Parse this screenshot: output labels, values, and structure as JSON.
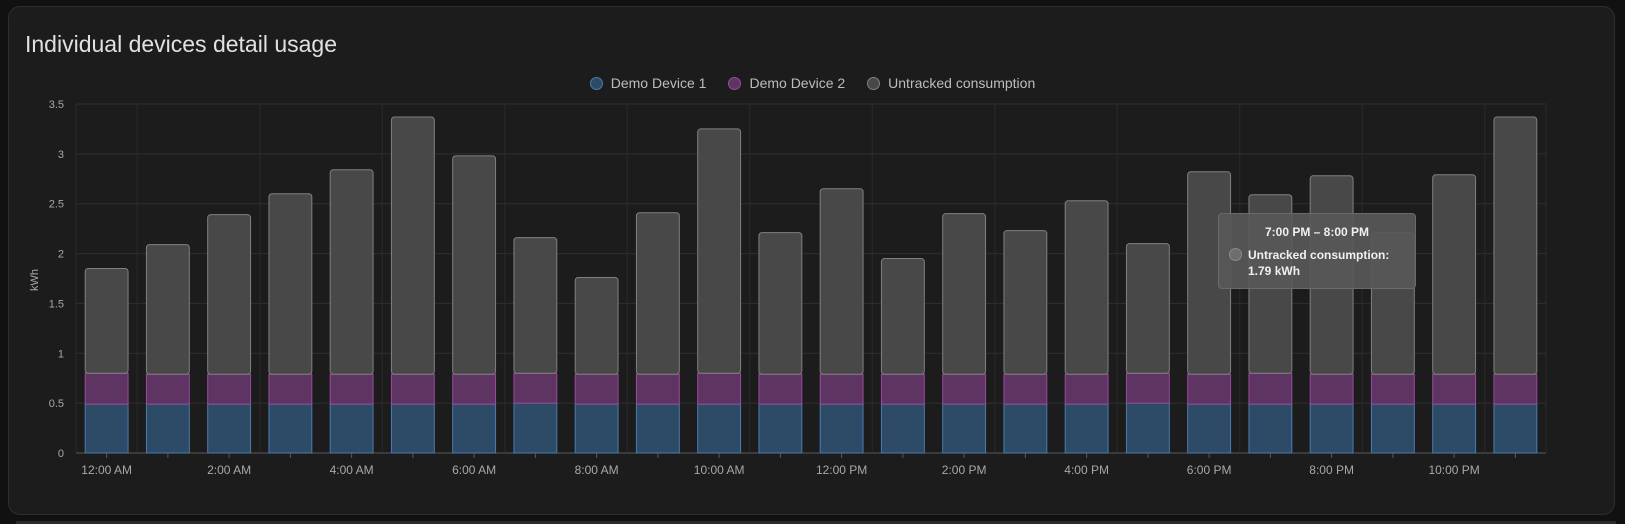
{
  "card": {
    "title": "Individual devices detail usage"
  },
  "chart_data": {
    "type": "bar",
    "stacked": true,
    "ylabel": "kWh",
    "ylim": [
      0,
      3.5
    ],
    "yticks": [
      "0",
      "0.5",
      "1",
      "1.5",
      "2",
      "2.5",
      "3",
      "3.5"
    ],
    "x_tick_labels": [
      "12:00 AM",
      "2:00 AM",
      "4:00 AM",
      "6:00 AM",
      "8:00 AM",
      "10:00 AM",
      "12:00 PM",
      "2:00 PM",
      "4:00 PM",
      "6:00 PM",
      "8:00 PM",
      "10:00 PM"
    ],
    "legend_position": "top-center",
    "grid": true,
    "series": [
      {
        "name": "Demo Device 1",
        "color": "#4a7bb0",
        "fill": "#2d4a66",
        "values": [
          0.49,
          0.49,
          0.49,
          0.49,
          0.49,
          0.49,
          0.49,
          0.5,
          0.49,
          0.49,
          0.49,
          0.49,
          0.49,
          0.49,
          0.49,
          0.49,
          0.49,
          0.5,
          0.49,
          0.49,
          0.49,
          0.49,
          0.49,
          0.49
        ]
      },
      {
        "name": "Demo Device 2",
        "color": "#9a4a9e",
        "fill": "#5e3462",
        "values": [
          0.31,
          0.3,
          0.3,
          0.3,
          0.3,
          0.3,
          0.3,
          0.3,
          0.3,
          0.3,
          0.31,
          0.3,
          0.3,
          0.3,
          0.3,
          0.3,
          0.3,
          0.3,
          0.3,
          0.31,
          0.3,
          0.3,
          0.3,
          0.3
        ]
      },
      {
        "name": "Untracked consumption",
        "color": "#808080",
        "fill": "#484848",
        "values": [
          1.05,
          1.3,
          1.6,
          1.81,
          2.05,
          2.58,
          2.19,
          1.36,
          0.97,
          1.62,
          2.45,
          1.42,
          1.86,
          1.16,
          1.61,
          1.44,
          1.74,
          1.3,
          2.03,
          1.79,
          1.99,
          1.42,
          2.0,
          2.58
        ]
      }
    ]
  },
  "tooltip": {
    "title": "7:00 PM – 8:00 PM",
    "label": "Untracked consumption:",
    "value": "1.79 kWh"
  }
}
